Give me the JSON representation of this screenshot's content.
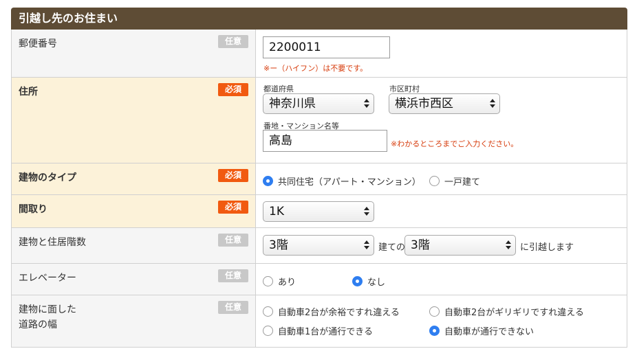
{
  "section_title": "引越し先のお住まい",
  "badges": {
    "optional": "任意",
    "required": "必須"
  },
  "postal": {
    "label": "郵便番号",
    "value": "2200011",
    "note": "※ー（ハイフン）は不要です。"
  },
  "address": {
    "label": "住所",
    "prefecture_label": "都道府県",
    "prefecture_value": "神奈川県",
    "city_label": "市区町村",
    "city_value": "横浜市西区",
    "street_label": "番地・マンション名等",
    "street_value": "高島",
    "street_note": "※わかるところまでご入力ください。"
  },
  "building_type": {
    "label": "建物のタイプ",
    "options": [
      "共同住宅（アパート・マンション）",
      "一戸建て"
    ],
    "selected": 0
  },
  "layout": {
    "label": "間取り",
    "value": "1K"
  },
  "floors": {
    "label": "建物と住居階数",
    "total_value": "3階",
    "middle_text": "建ての",
    "floor_value": "3階",
    "suffix_text": "に引越します"
  },
  "elevator": {
    "label": "エレベーター",
    "options": [
      "あり",
      "なし"
    ],
    "selected": 1
  },
  "road": {
    "label_line1": "建物に面した",
    "label_line2": "道路の幅",
    "options": [
      "自動車2台が余裕ですれ違える",
      "自動車2台がギリギリですれ違える",
      "自動車1台が通行できる",
      "自動車が通行できない"
    ],
    "selected": 3
  },
  "colors": {
    "header_bg": "#5e4c35",
    "required_badge": "#f15a10",
    "optional_badge": "#c8c8c8",
    "required_row_bg": "#fcf2d9",
    "note_text": "#d63a0a",
    "radio_selected": "#2f7ef0"
  }
}
